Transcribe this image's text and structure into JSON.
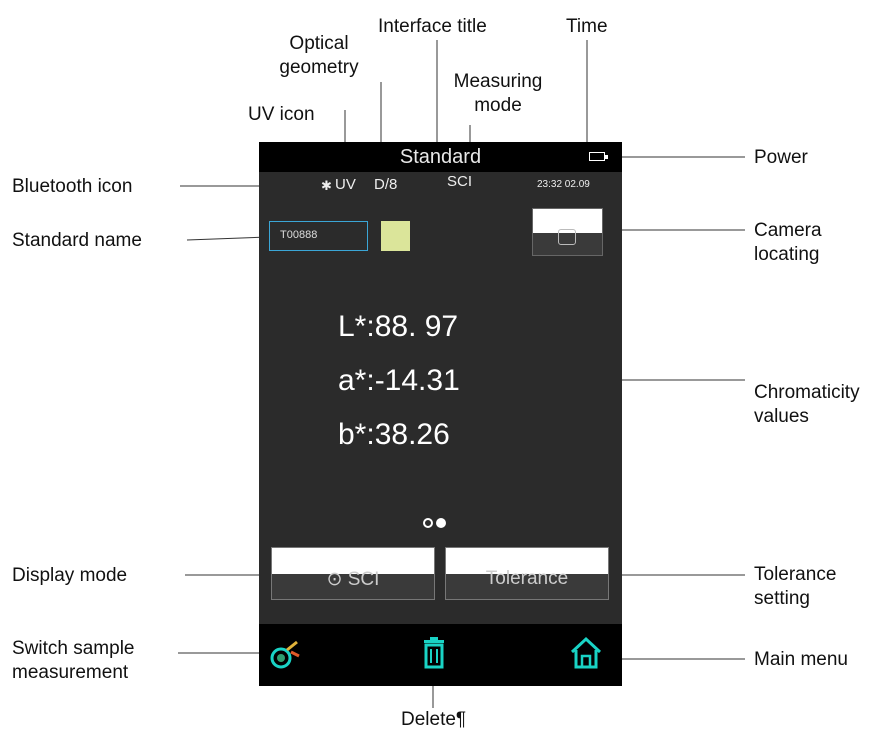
{
  "callouts": {
    "interface_title": "Interface title",
    "time": "Time",
    "optical_geometry_1": "Optical",
    "optical_geometry_2": "geometry",
    "measuring_mode_1": "Measuring",
    "measuring_mode_2": "mode",
    "uv_icon": "UV icon",
    "power": "Power",
    "bluetooth_icon": "Bluetooth icon",
    "standard_name": "Standard name",
    "camera_locating_1": "Camera",
    "camera_locating_2": "locating",
    "chromaticity_values_1": "Chromaticity",
    "chromaticity_values_2": "values",
    "display_mode": "Display mode",
    "tolerance_setting_1": "Tolerance",
    "tolerance_setting_2": "setting",
    "switch_sample_1": "Switch sample",
    "switch_sample_2": "measurement",
    "main_menu": "Main menu",
    "delete": "Delete¶"
  },
  "screen": {
    "title": "Standard",
    "status": {
      "bluetooth": "✱",
      "uv": "UV",
      "geometry": "D/8",
      "mode": "SCI",
      "time": "23:32 02.09"
    },
    "standard_name": "T00888",
    "swatch_color": "#dbe59a",
    "values": {
      "l": "L*:88. 97",
      "a": "a*:-14.31",
      "b": "b*:38.26"
    },
    "buttons": {
      "display_mode": "⊙ SCI",
      "tolerance": "Tolerance"
    },
    "icons": {
      "switch": "switch-sample-icon",
      "delete": "trash-icon",
      "home": "home-icon"
    },
    "accent_color": "#19d3c5"
  }
}
